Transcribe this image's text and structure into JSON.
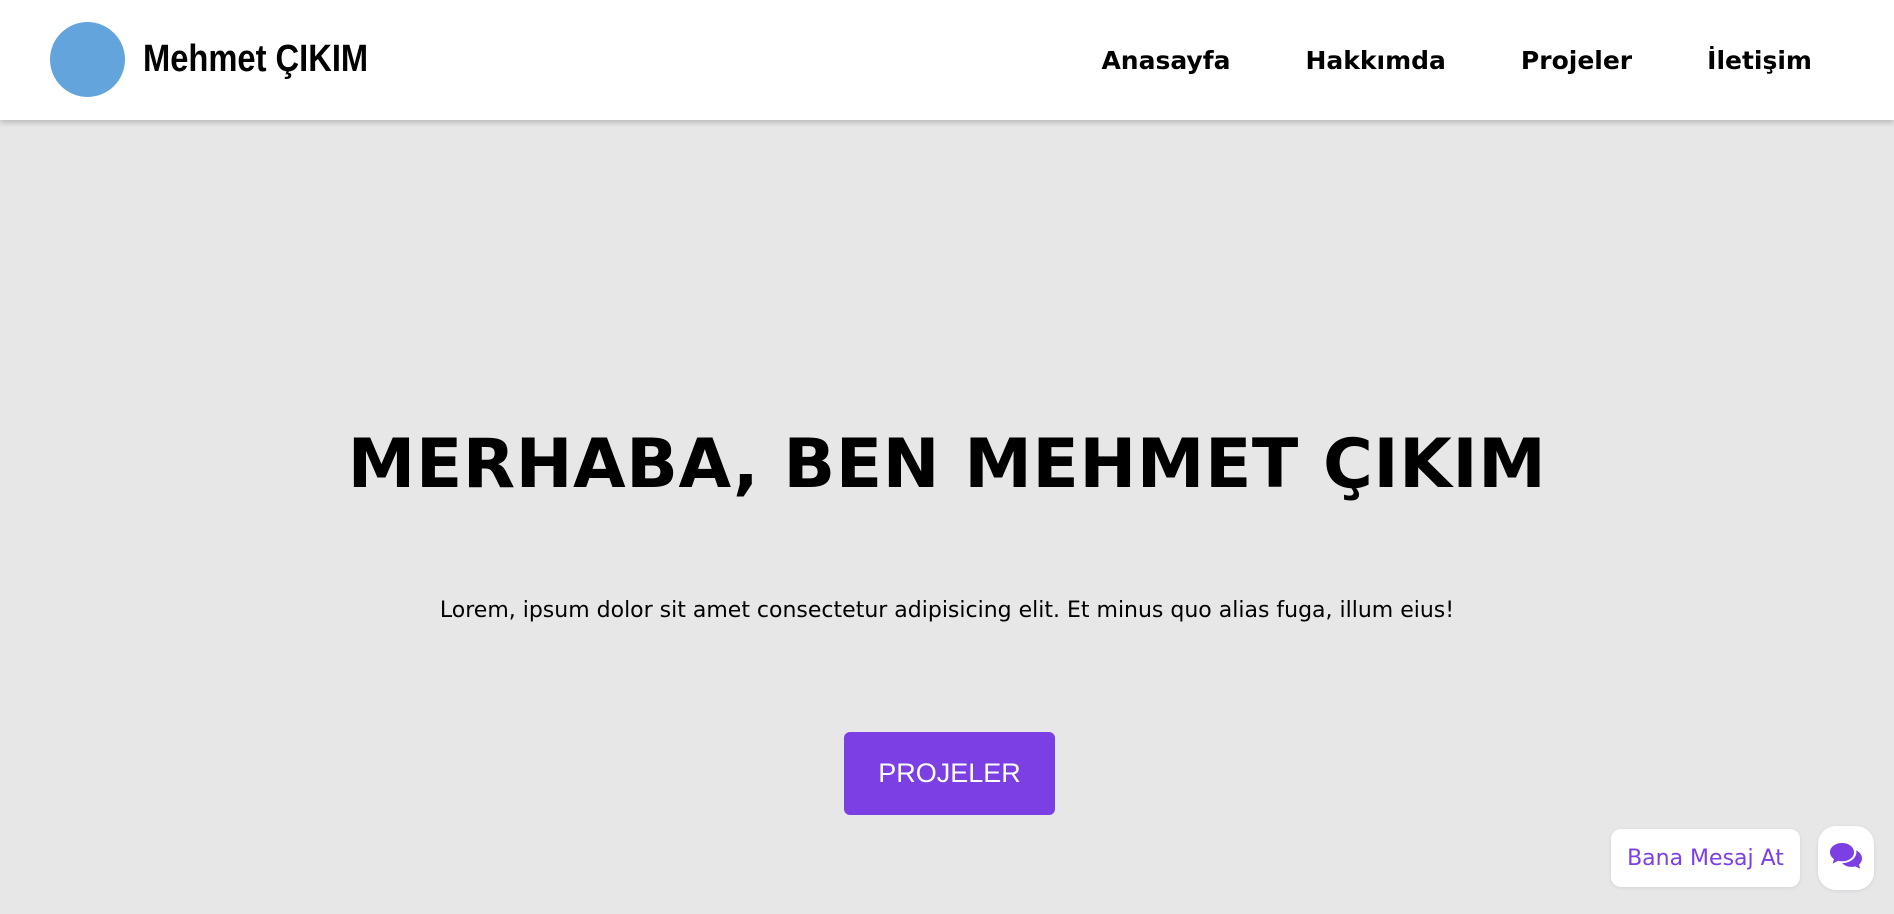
{
  "header": {
    "brand_name": "Mehmet ÇIKIM",
    "nav": [
      {
        "label": "Anasayfa"
      },
      {
        "label": "Hakkımda"
      },
      {
        "label": "Projeler"
      },
      {
        "label": "İletişim"
      }
    ]
  },
  "hero": {
    "title": "MERHABA, BEN MEHMET ÇIKIM",
    "subtitle": "Lorem, ipsum dolor sit amet consectetur adipisicing elit. Et minus quo alias fuga, illum eius!",
    "button_label": "PROJELER"
  },
  "chat_widget": {
    "label": "Bana Mesaj At",
    "icon": "comments-icon"
  },
  "colors": {
    "accent": "#7b3fe4",
    "avatar": "#64a4dc",
    "background": "#e7e7e8",
    "header_bg": "#ffffff"
  }
}
